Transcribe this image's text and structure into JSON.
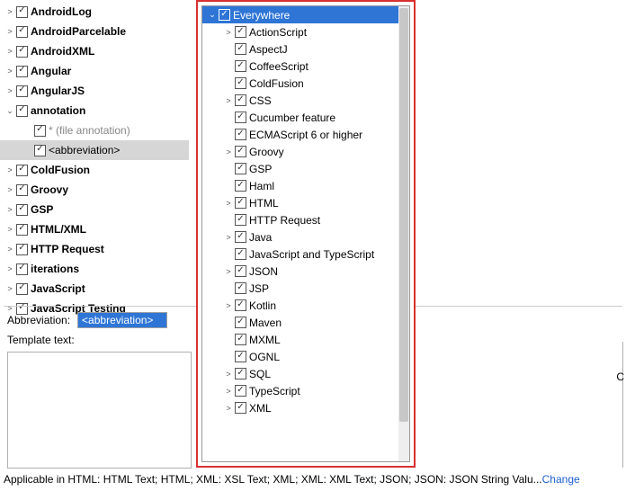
{
  "leftTree": [
    {
      "label": "AndroidLog",
      "bold": true,
      "indent": 0,
      "arrow": ">"
    },
    {
      "label": "AndroidParcelable",
      "bold": true,
      "indent": 0,
      "arrow": ">"
    },
    {
      "label": "AndroidXML",
      "bold": true,
      "indent": 0,
      "arrow": ">"
    },
    {
      "label": "Angular",
      "bold": true,
      "indent": 0,
      "arrow": ">"
    },
    {
      "label": "AngularJS",
      "bold": true,
      "indent": 0,
      "arrow": ">"
    },
    {
      "label": "annotation",
      "bold": true,
      "indent": 0,
      "arrow": "v"
    },
    {
      "label": "* (file annotation)",
      "bold": false,
      "indent": 1,
      "arrow": "",
      "gray": true
    },
    {
      "label": "<abbreviation>",
      "bold": false,
      "indent": 1,
      "arrow": "",
      "highlight": true,
      "bracket": true
    },
    {
      "label": "ColdFusion",
      "bold": true,
      "indent": 0,
      "arrow": ">"
    },
    {
      "label": "Groovy",
      "bold": true,
      "indent": 0,
      "arrow": ">"
    },
    {
      "label": "GSP",
      "bold": true,
      "indent": 0,
      "arrow": ">"
    },
    {
      "label": "HTML/XML",
      "bold": true,
      "indent": 0,
      "arrow": ">"
    },
    {
      "label": "HTTP Request",
      "bold": true,
      "indent": 0,
      "arrow": ">"
    },
    {
      "label": "iterations",
      "bold": true,
      "indent": 0,
      "arrow": ">"
    },
    {
      "label": "JavaScript",
      "bold": true,
      "indent": 0,
      "arrow": ">"
    },
    {
      "label": "JavaScript Testing",
      "bold": true,
      "indent": 0,
      "arrow": ">"
    }
  ],
  "form": {
    "abbreviationLabel": "Abbreviation:",
    "abbreviationValue": "<abbreviation>",
    "templateLabel": "Template text:"
  },
  "status": {
    "text": "Applicable in HTML: HTML Text; HTML; XML: XSL Text; XML; XML: XML Text; JSON; JSON: JSON String Valu...",
    "link": "Change"
  },
  "rightLetter": "C",
  "popup": [
    {
      "label": "Everywhere",
      "arrow": "v",
      "indent": 0,
      "sel": true
    },
    {
      "label": "ActionScript",
      "arrow": ">",
      "indent": 1
    },
    {
      "label": "AspectJ",
      "arrow": "",
      "indent": 1
    },
    {
      "label": "CoffeeScript",
      "arrow": "",
      "indent": 1
    },
    {
      "label": "ColdFusion",
      "arrow": "",
      "indent": 1
    },
    {
      "label": "CSS",
      "arrow": ">",
      "indent": 1
    },
    {
      "label": "Cucumber feature",
      "arrow": "",
      "indent": 1
    },
    {
      "label": "ECMAScript 6 or higher",
      "arrow": "",
      "indent": 1
    },
    {
      "label": "Groovy",
      "arrow": ">",
      "indent": 1
    },
    {
      "label": "GSP",
      "arrow": "",
      "indent": 1
    },
    {
      "label": "Haml",
      "arrow": "",
      "indent": 1
    },
    {
      "label": "HTML",
      "arrow": ">",
      "indent": 1
    },
    {
      "label": "HTTP Request",
      "arrow": "",
      "indent": 1
    },
    {
      "label": "Java",
      "arrow": ">",
      "indent": 1
    },
    {
      "label": "JavaScript and TypeScript",
      "arrow": "",
      "indent": 1
    },
    {
      "label": "JSON",
      "arrow": ">",
      "indent": 1
    },
    {
      "label": "JSP",
      "arrow": "",
      "indent": 1
    },
    {
      "label": "Kotlin",
      "arrow": ">",
      "indent": 1
    },
    {
      "label": "Maven",
      "arrow": "",
      "indent": 1
    },
    {
      "label": "MXML",
      "arrow": "",
      "indent": 1
    },
    {
      "label": "OGNL",
      "arrow": "",
      "indent": 1
    },
    {
      "label": "SQL",
      "arrow": ">",
      "indent": 1
    },
    {
      "label": "TypeScript",
      "arrow": ">",
      "indent": 1
    },
    {
      "label": "XML",
      "arrow": ">",
      "indent": 1
    }
  ]
}
